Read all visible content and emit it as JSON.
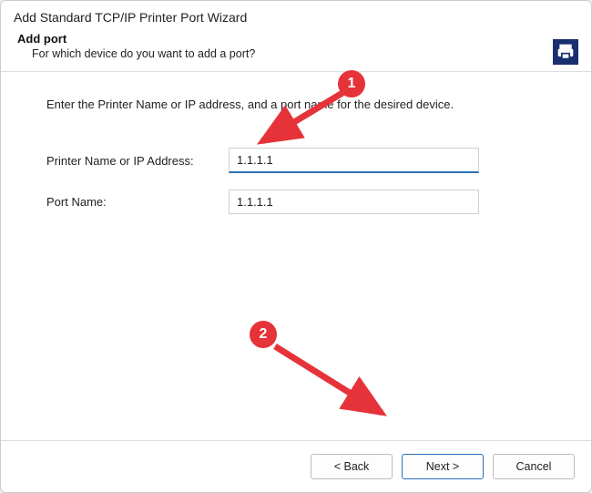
{
  "wizard": {
    "title": "Add Standard TCP/IP Printer Port Wizard",
    "page_title": "Add port",
    "subtitle": "For which device do you want to add a port?",
    "icon_name": "printer-icon"
  },
  "content": {
    "intro": "Enter the Printer Name or IP address, and a port name for the desired device.",
    "fields": {
      "printer_address": {
        "label": "Printer Name or IP Address:",
        "value": "1.1.1.1"
      },
      "port_name": {
        "label": "Port Name:",
        "value": "1.1.1.1"
      }
    }
  },
  "footer": {
    "back": "< Back",
    "next": "Next >",
    "cancel": "Cancel"
  },
  "annotations": {
    "callout1": "1",
    "callout2": "2"
  }
}
